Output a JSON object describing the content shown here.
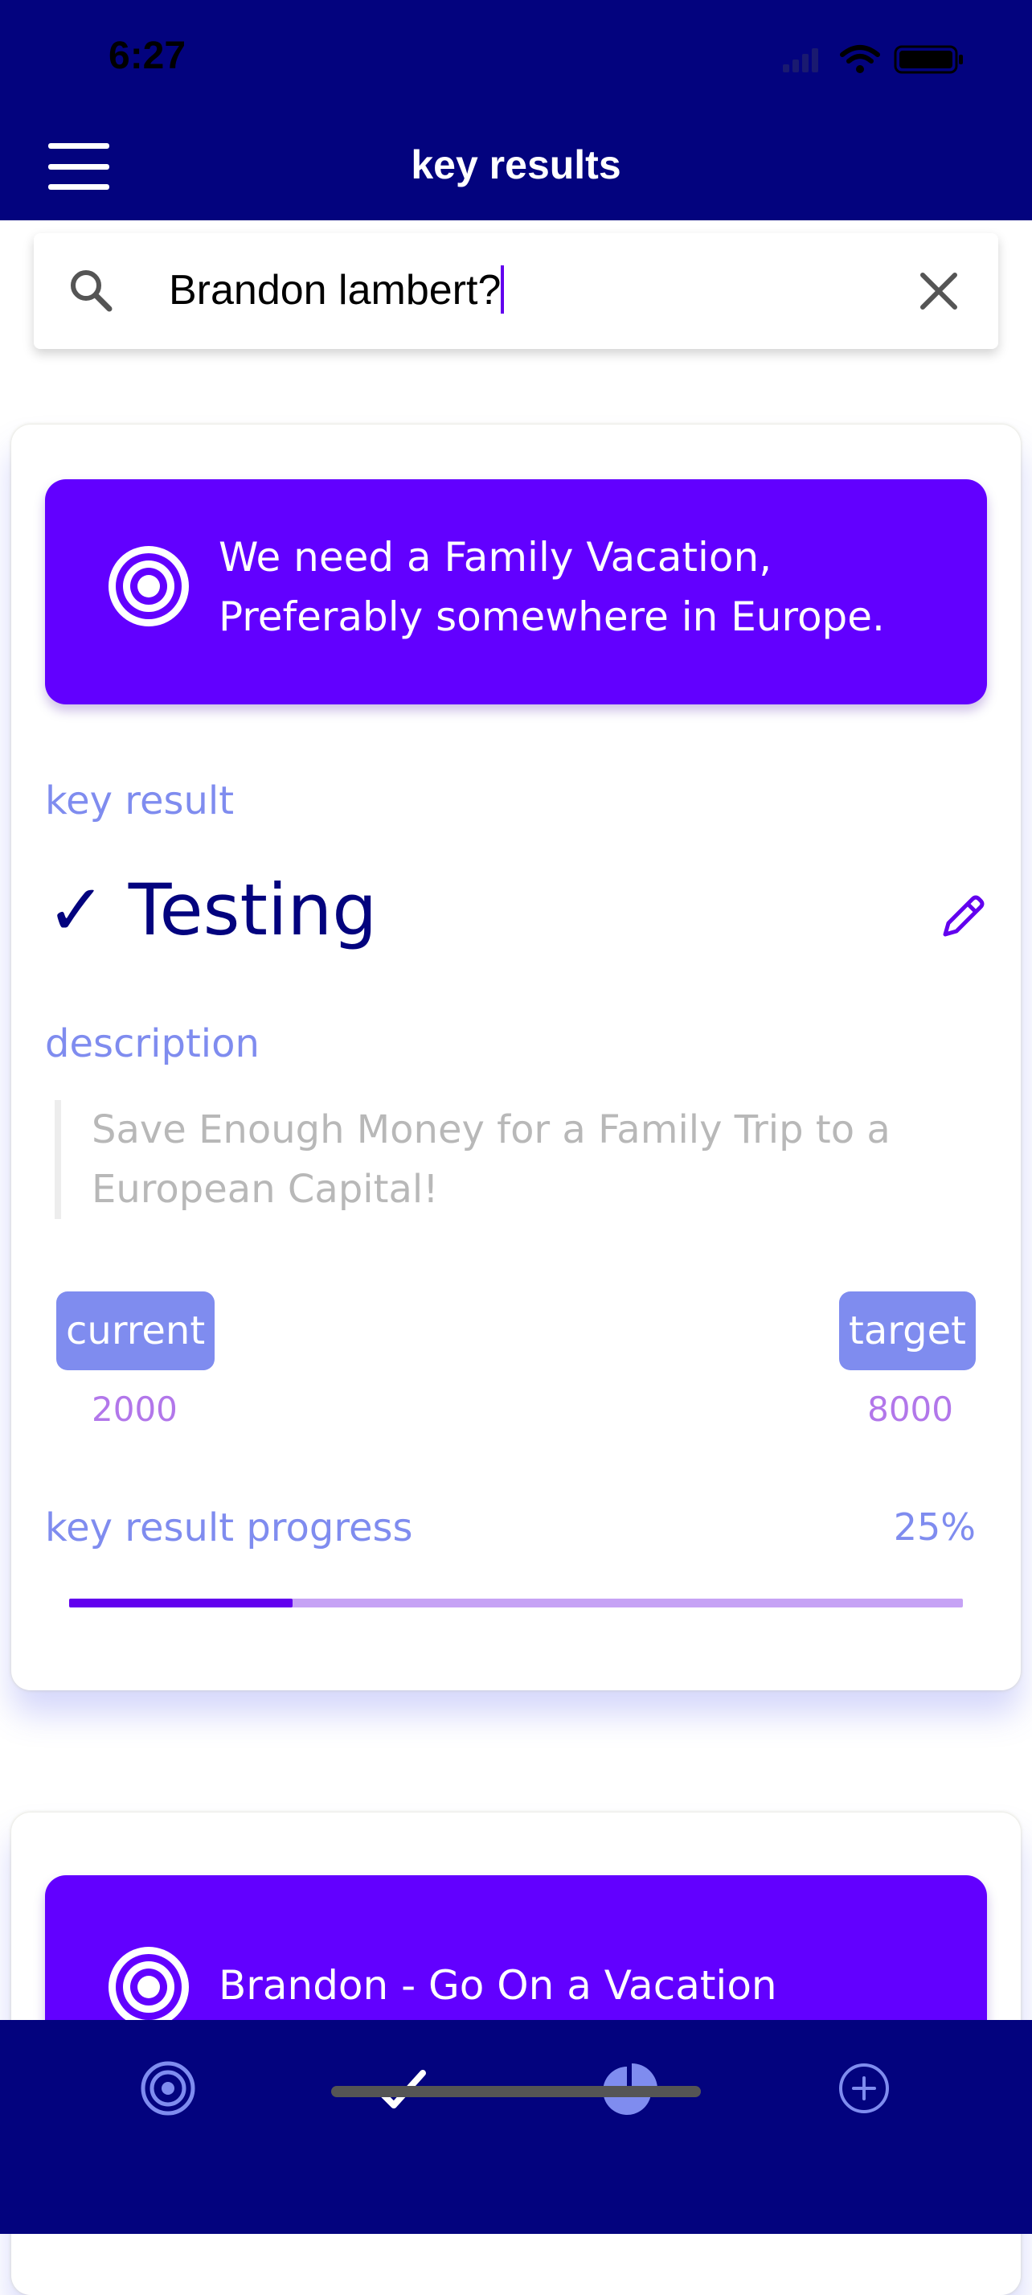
{
  "status_bar": {
    "time": "6:27"
  },
  "header": {
    "title": "key results"
  },
  "search": {
    "value": "Brandon lambert?"
  },
  "cards": [
    {
      "objective": "We need a Family Vacation, Preferably somewhere in Europe.",
      "section_label": "key result",
      "title": "✓ Testing",
      "description_label": "description",
      "description": "Save Enough Money for a Family Trip to a European Capital!",
      "current_label": "current",
      "current_value": "2000",
      "target_label": "target",
      "target_value": "8000",
      "progress_label": "key result progress",
      "progress_text": "25%",
      "progress_fraction": 0.25
    },
    {
      "objective": "Brandon - Go On a Vacation"
    }
  ],
  "bottom_nav": [
    {
      "icon": "target-icon"
    },
    {
      "icon": "check-icon"
    },
    {
      "icon": "pie-chart-icon"
    },
    {
      "icon": "add-circle-icon"
    }
  ],
  "colors": {
    "header": "#03037e",
    "objective": "#6200ff",
    "accent": "#7f8cef",
    "value": "#b277ea",
    "progress_fill": "#6200ee",
    "progress_track": "#c6a2f5"
  }
}
